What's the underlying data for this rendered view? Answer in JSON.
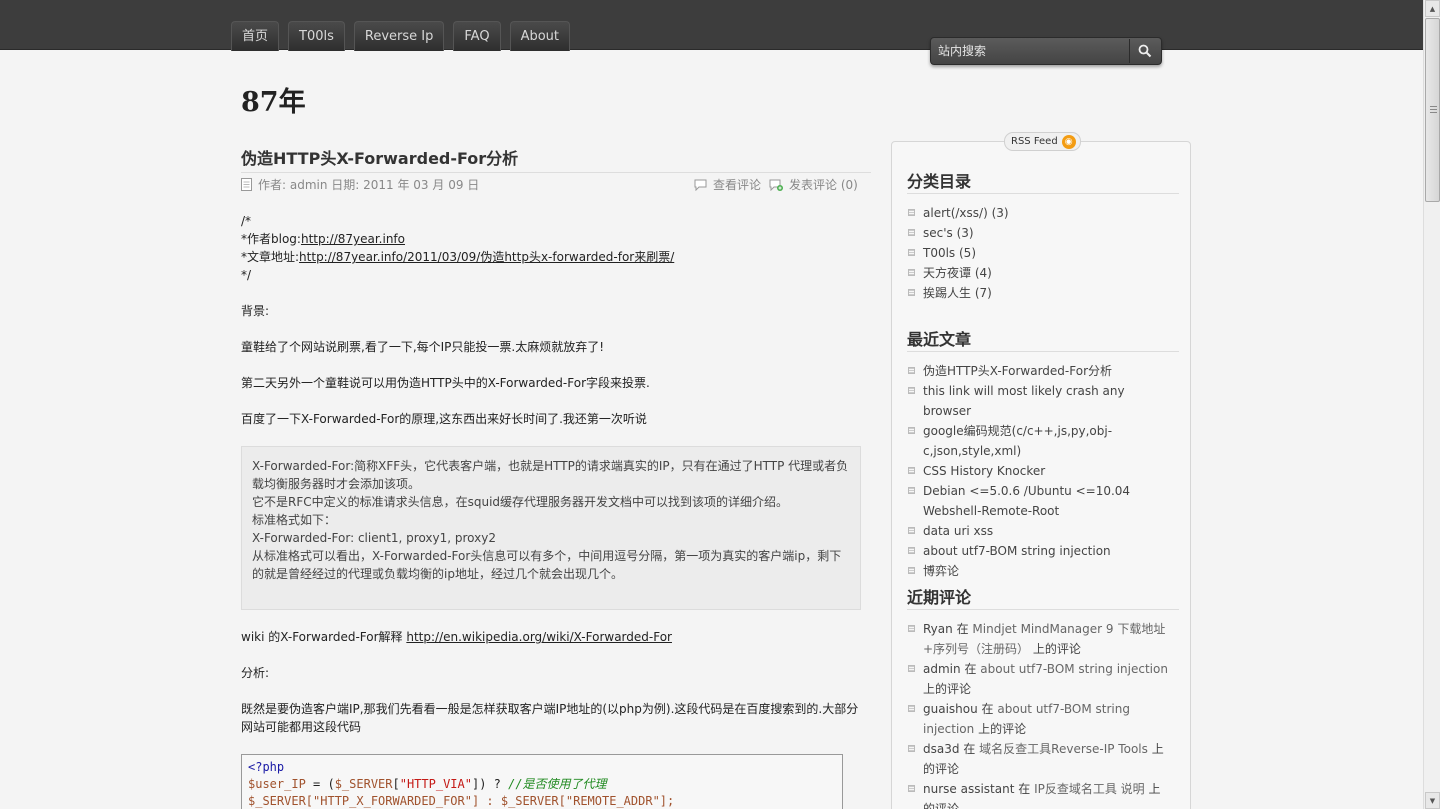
{
  "nav": {
    "items": [
      "首页",
      "T00ls",
      "Reverse Ip",
      "FAQ",
      "About"
    ]
  },
  "search": {
    "placeholder": "站内搜索"
  },
  "site": {
    "title": "87年"
  },
  "post": {
    "title": "伪造HTTP头X-Forwarded-For分析",
    "meta": {
      "author_date": "作者: admin 日期: 2011 年 03 月 09 日",
      "view_comments": "查看评论",
      "post_comment": "发表评论 (0)"
    },
    "header_comment": {
      "open": "/*",
      "author_label": "*作者blog:",
      "author_link": "http://87year.info",
      "url_label": "*文章地址:",
      "url_link": "http://87year.info/2011/03/09/伪造http头x-forwarded-for来刷票/",
      "close": "*/"
    },
    "p_background": "背景:",
    "p1": "童鞋给了个网站说刷票,看了一下,每个IP只能投一票.太麻烦就放弃了!",
    "p2": "第二天另外一个童鞋说可以用伪造HTTP头中的X-Forwarded-For字段来投票.",
    "p3": "百度了一下X-Forwarded-For的原理,这东西出来好长时间了.我还第一次听说",
    "quote": [
      "X-Forwarded-For:简称XFF头，它代表客户端，也就是HTTP的请求端真实的IP，只有在通过了HTTP 代理或者负载均衡服务器时才会添加该项。",
      "它不是RFC中定义的标准请求头信息，在squid缓存代理服务器开发文档中可以找到该项的详细介绍。",
      "标准格式如下：",
      "X-Forwarded-For: client1, proxy1, proxy2",
      "从标准格式可以看出，X-Forwarded-For头信息可以有多个，中间用逗号分隔，第一项为真实的客户端ip，剩下的就是曾经经过的代理或负载均衡的ip地址，经过几个就会出现几个。"
    ],
    "wiki_label": "wiki 的X-Forwarded-For解释 ",
    "wiki_link": "http://en.wikipedia.org/wiki/X-Forwarded-For",
    "p_analysis": "分析:",
    "p4": "既然是要伪造客户端IP,那我们先看看一般是怎样获取客户端IP地址的(以php为例).这段代码是在百度搜索到的.大部分网站可能都用这段代码",
    "code": {
      "l1": "<?php",
      "l2_var": "$user_IP",
      "l2_mid": " = (",
      "l2_srv": "$_SERVER",
      "l2_key": "\"HTTP_VIA\"",
      "l2_end": "]) ? ",
      "l2_cmt": "//是否使用了代理",
      "l3": "$_SERVER[\"HTTP_X_FORWARDED_FOR\"] : $_SERVER[\"REMOTE_ADDR\"];"
    }
  },
  "sidebar": {
    "rss": "RSS Feed",
    "categories_title": "分类目录",
    "categories": [
      "alert(/xss/) (3)",
      "sec's (3)",
      "T00ls (5)",
      "天方夜谭 (4)",
      "挨踢人生 (7)"
    ],
    "recent_title": "最近文章",
    "recent": [
      "伪造HTTP头X-Forwarded-For分析",
      "this link will most likely crash any browser",
      "google编码规范(c/c++,js,py,obj-c,json,style,xml)",
      "CSS History Knocker",
      "Debian <=5.0.6 /Ubuntu <=10.04 Webshell-Remote-Root",
      "data uri xss",
      "about utf7-BOM string injection",
      "博弈论"
    ],
    "comments_title": "近期评论",
    "comments": [
      {
        "who": "Ryan",
        "on": "在",
        "post": "Mindjet MindManager 9 下载地址+序列号（注册码）",
        "tail": "上的评论"
      },
      {
        "who": "admin",
        "on": "在",
        "post": "about utf7-BOM string injection",
        "tail": "上的评论"
      },
      {
        "who": "guaishou",
        "on": "在",
        "post": "about utf7-BOM string injection",
        "tail": "上的评论"
      },
      {
        "who": "dsa3d",
        "on": "在",
        "post": "域名反查工具Reverse-IP Tools",
        "tail": "上的评论"
      },
      {
        "who": "nurse assistant",
        "on": "在",
        "post": "IP反查域名工具 说明",
        "tail": "上的评论"
      }
    ]
  }
}
